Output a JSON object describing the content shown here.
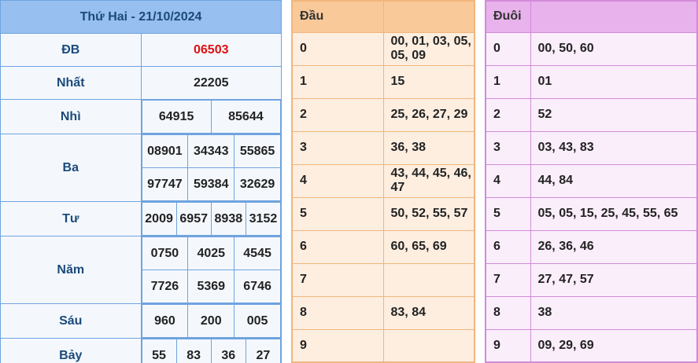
{
  "results": {
    "title": "Thứ Hai - 21/10/2024",
    "prizes": [
      {
        "label": "ĐB",
        "rows": [
          [
            "06503"
          ]
        ]
      },
      {
        "label": "Nhất",
        "rows": [
          [
            "22205"
          ]
        ]
      },
      {
        "label": "Nhì",
        "rows": [
          [
            "64915",
            "85644"
          ]
        ]
      },
      {
        "label": "Ba",
        "rows": [
          [
            "08901",
            "34343",
            "55865"
          ],
          [
            "97747",
            "59384",
            "32629"
          ]
        ]
      },
      {
        "label": "Tư",
        "rows": [
          [
            "2009",
            "6957",
            "8938",
            "3152"
          ]
        ]
      },
      {
        "label": "Năm",
        "rows": [
          [
            "0750",
            "4025",
            "4545"
          ],
          [
            "7726",
            "5369",
            "6746"
          ]
        ]
      },
      {
        "label": "Sáu",
        "rows": [
          [
            "960",
            "200",
            "005"
          ]
        ]
      },
      {
        "label": "Bảy",
        "rows": [
          [
            "55",
            "83",
            "36",
            "27"
          ]
        ]
      }
    ]
  },
  "dau": {
    "header": "Đầu",
    "rows": [
      {
        "digit": "0",
        "values": "00, 01, 03, 05, 05, 09"
      },
      {
        "digit": "1",
        "values": "15"
      },
      {
        "digit": "2",
        "values": "25, 26, 27, 29"
      },
      {
        "digit": "3",
        "values": "36, 38"
      },
      {
        "digit": "4",
        "values": "43, 44, 45, 46, 47"
      },
      {
        "digit": "5",
        "values": "50, 52, 55, 57"
      },
      {
        "digit": "6",
        "values": "60, 65, 69"
      },
      {
        "digit": "7",
        "values": ""
      },
      {
        "digit": "8",
        "values": "83, 84"
      },
      {
        "digit": "9",
        "values": ""
      }
    ]
  },
  "duoi": {
    "header": "Đuôi",
    "rows": [
      {
        "digit": "0",
        "values": "00, 50, 60"
      },
      {
        "digit": "1",
        "values": "01"
      },
      {
        "digit": "2",
        "values": "52"
      },
      {
        "digit": "3",
        "values": "03, 43, 83"
      },
      {
        "digit": "4",
        "values": "44, 84"
      },
      {
        "digit": "5",
        "values": "05, 05, 15, 25, 45, 55, 65"
      },
      {
        "digit": "6",
        "values": "26, 36, 46"
      },
      {
        "digit": "7",
        "values": "27, 47, 57"
      },
      {
        "digit": "8",
        "values": "38"
      },
      {
        "digit": "9",
        "values": "09, 29, 69"
      }
    ]
  },
  "colors": {
    "special_prize": "#e01010",
    "results_header": "#97bff0",
    "dau_header": "#f9c99a",
    "duoi_header": "#e8b2ec"
  }
}
